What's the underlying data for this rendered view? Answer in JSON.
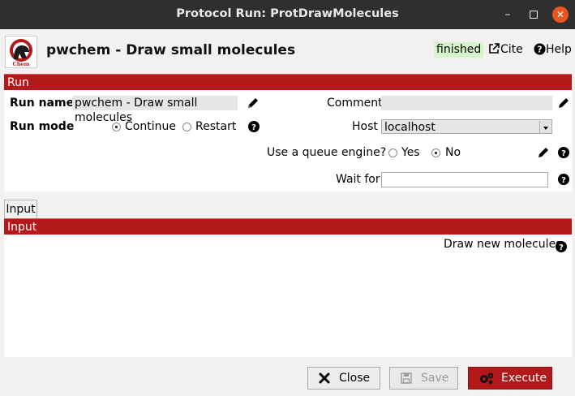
{
  "window": {
    "title": "Protocol Run: ProtDrawMolecules",
    "minimize_label": "–",
    "maximize_label": "☐",
    "close_label": "✕"
  },
  "header": {
    "logo_text": "Chem",
    "title": "pwchem - Draw small molecules",
    "status": "finished",
    "cite_label": "Cite",
    "help_label": "Help",
    "status_color": "#d4f5c8"
  },
  "run_section": {
    "bar_label": "Run",
    "run_name_label": "Run name",
    "run_name_value": "pwchem - Draw small molecules",
    "comment_label": "Comment",
    "comment_value": "",
    "run_mode_label": "Run mode",
    "run_mode_options": [
      "Continue",
      "Restart"
    ],
    "run_mode_selected": "Continue",
    "host_label": "Host",
    "host_value": "localhost",
    "queue_label": "Use a queue engine?",
    "queue_options": [
      "Yes",
      "No"
    ],
    "queue_selected": "No",
    "wait_for_label": "Wait for",
    "wait_for_value": ""
  },
  "tabs": [
    {
      "label": "Input"
    }
  ],
  "input_section": {
    "bar_label": "Input",
    "draw_label": "Draw new molecules"
  },
  "footer": {
    "close_label": "Close",
    "save_label": "Save",
    "execute_label": "Execute"
  },
  "colors": {
    "accent": "#b3191b",
    "titlebar": "#2f2f2f",
    "window_close": "#e95420"
  }
}
